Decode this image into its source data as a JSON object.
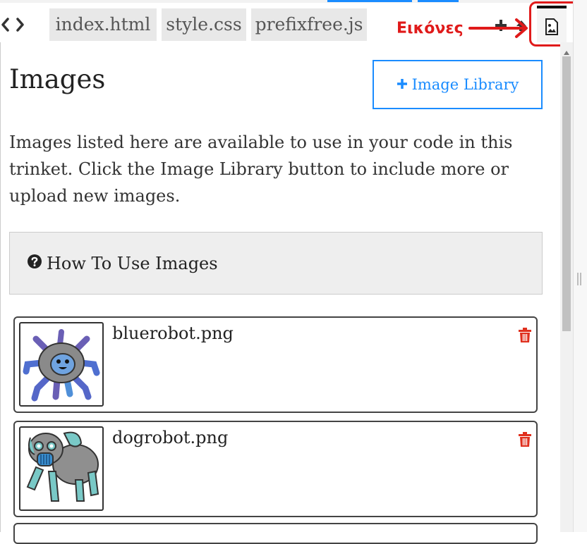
{
  "tabs": [
    {
      "label": "index.html"
    },
    {
      "label": "style.css"
    },
    {
      "label": "prefixfree.js"
    }
  ],
  "annotation": {
    "label": "Εικόνες",
    "color": "#e01a1a"
  },
  "panel": {
    "title": "Images",
    "library_button": "Image Library",
    "description": "Images listed here are available to use in your code in this trinket. Click the Image Library button to include more or upload new images.",
    "howto": "How To Use Images"
  },
  "images": [
    {
      "filename": "bluerobot.png"
    },
    {
      "filename": "dogrobot.png"
    }
  ],
  "colors": {
    "accent": "#1a8cff",
    "delete": "#e0301e"
  }
}
